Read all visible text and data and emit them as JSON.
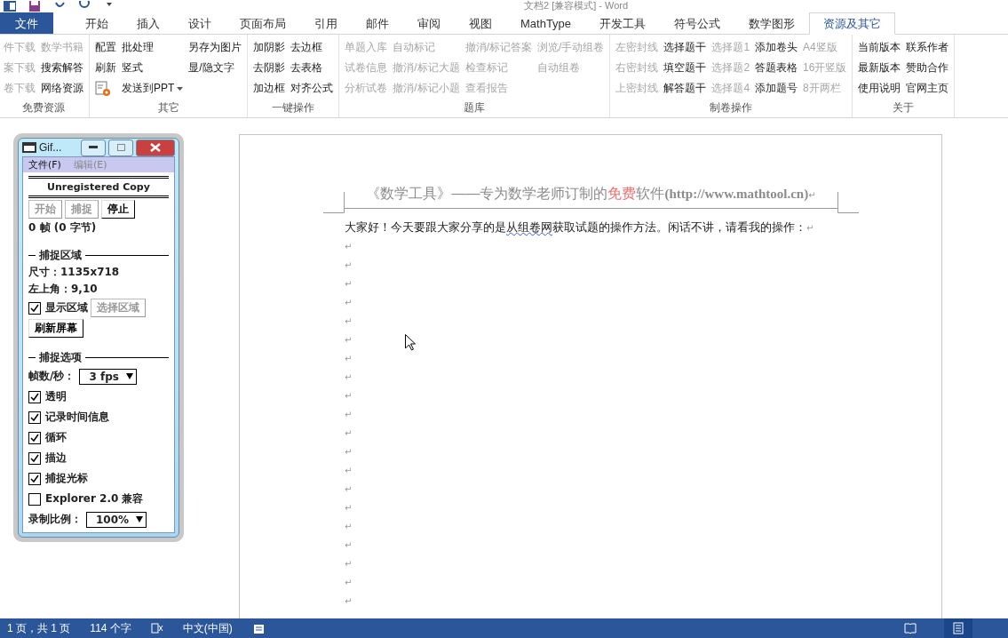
{
  "window": {
    "title": "文档2 [兼容模式] - Word"
  },
  "tabs": [
    {
      "label": "文件",
      "kind": "file",
      "selected": false
    },
    {
      "label": "开始",
      "kind": "tab",
      "selected": false
    },
    {
      "label": "插入",
      "kind": "tab",
      "selected": false
    },
    {
      "label": "设计",
      "kind": "tab",
      "selected": false
    },
    {
      "label": "页面布局",
      "kind": "tab",
      "selected": false
    },
    {
      "label": "引用",
      "kind": "tab",
      "selected": false
    },
    {
      "label": "邮件",
      "kind": "tab",
      "selected": false
    },
    {
      "label": "审阅",
      "kind": "tab",
      "selected": false
    },
    {
      "label": "视图",
      "kind": "tab",
      "selected": false
    },
    {
      "label": "MathType",
      "kind": "tab",
      "selected": false
    },
    {
      "label": "开发工具",
      "kind": "tab",
      "selected": false
    },
    {
      "label": "符号公式",
      "kind": "tab",
      "selected": false
    },
    {
      "label": "数学图形",
      "kind": "tab",
      "selected": false
    },
    {
      "label": "资源及其它",
      "kind": "tab",
      "selected": true
    }
  ],
  "ribbon_groups": [
    {
      "title": "免费资源",
      "columns": [
        [
          {
            "label": "件下载",
            "kind": "text",
            "disabled": true
          },
          {
            "label": "案下载",
            "kind": "text",
            "disabled": true
          },
          {
            "label": "卷下载",
            "kind": "text",
            "disabled": true
          }
        ],
        [
          {
            "label": "数学书籍",
            "kind": "text",
            "disabled": true
          },
          {
            "label": "搜索解答",
            "kind": "text",
            "disabled": false
          },
          {
            "label": "网络资源",
            "kind": "text",
            "disabled": false
          }
        ]
      ]
    },
    {
      "title": "其它",
      "columns": [
        [
          {
            "label": "配置",
            "kind": "text",
            "disabled": false
          },
          {
            "label": "刷新",
            "kind": "text",
            "disabled": false
          },
          {
            "kind": "icon",
            "disabled": false
          }
        ],
        [
          {
            "label": "批处理",
            "kind": "text",
            "disabled": false
          },
          {
            "label": "竖式",
            "kind": "text",
            "disabled": false
          },
          {
            "label": "发送到PPT",
            "kind": "dropdown",
            "disabled": false
          }
        ],
        [
          {
            "label": "另存为图片",
            "kind": "text",
            "disabled": false
          },
          {
            "label": "显/隐文字",
            "kind": "text",
            "disabled": false
          }
        ]
      ]
    },
    {
      "title": "一键操作",
      "columns": [
        [
          {
            "label": "加阴影",
            "kind": "text",
            "disabled": false
          },
          {
            "label": "去阴影",
            "kind": "text",
            "disabled": false
          },
          {
            "label": "加边框",
            "kind": "text",
            "disabled": false
          }
        ],
        [
          {
            "label": "去边框",
            "kind": "text",
            "disabled": false
          },
          {
            "label": "去表格",
            "kind": "text",
            "disabled": false
          },
          {
            "label": "对齐公式",
            "kind": "text",
            "disabled": false
          }
        ]
      ]
    },
    {
      "title": "题库",
      "columns": [
        [
          {
            "label": "单题入库",
            "kind": "text",
            "disabled": true
          },
          {
            "label": "试卷信息",
            "kind": "text",
            "disabled": true
          },
          {
            "label": "分析试卷",
            "kind": "text",
            "disabled": true
          }
        ],
        [
          {
            "label": "自动标记",
            "kind": "text",
            "disabled": true
          },
          {
            "label": "撤消/标记大题",
            "kind": "text",
            "disabled": true
          },
          {
            "label": "撤消/标记小题",
            "kind": "text",
            "disabled": true
          }
        ],
        [
          {
            "label": "撤消/标记答案",
            "kind": "text",
            "disabled": true
          },
          {
            "label": "检查标记",
            "kind": "text",
            "disabled": true
          },
          {
            "label": "查看报告",
            "kind": "text",
            "disabled": true
          }
        ],
        [
          {
            "label": "浏览/手动组卷",
            "kind": "text",
            "disabled": true
          },
          {
            "label": "自动组卷",
            "kind": "text",
            "disabled": true
          }
        ]
      ]
    },
    {
      "title": "制卷操作",
      "columns": [
        [
          {
            "label": "左密封线",
            "kind": "text",
            "disabled": true
          },
          {
            "label": "右密封线",
            "kind": "text",
            "disabled": true
          },
          {
            "label": "上密封线",
            "kind": "text",
            "disabled": true
          }
        ],
        [
          {
            "label": "选择题干",
            "kind": "text",
            "disabled": false
          },
          {
            "label": "填空题干",
            "kind": "text",
            "disabled": false
          },
          {
            "label": "解答题干",
            "kind": "text",
            "disabled": false
          }
        ],
        [
          {
            "label": "选择题1",
            "kind": "text",
            "disabled": true
          },
          {
            "label": "选择题2",
            "kind": "text",
            "disabled": true
          },
          {
            "label": "选择题4",
            "kind": "text",
            "disabled": true
          }
        ],
        [
          {
            "label": "添加卷头",
            "kind": "text",
            "disabled": false
          },
          {
            "label": "答题表格",
            "kind": "text",
            "disabled": false
          },
          {
            "label": "添加题号",
            "kind": "text",
            "disabled": false
          }
        ],
        [
          {
            "label": "A4竖版",
            "kind": "text",
            "disabled": true
          },
          {
            "label": "16开竖版",
            "kind": "text",
            "disabled": true
          },
          {
            "label": "8开两栏",
            "kind": "text",
            "disabled": true
          }
        ]
      ]
    },
    {
      "title": "关于",
      "columns": [
        [
          {
            "label": "当前版本",
            "kind": "text",
            "disabled": false
          },
          {
            "label": "最新版本",
            "kind": "text",
            "disabled": false
          },
          {
            "label": "使用说明",
            "kind": "text",
            "disabled": false
          }
        ],
        [
          {
            "label": "联系作者",
            "kind": "text",
            "disabled": false
          },
          {
            "label": "赞助合作",
            "kind": "text",
            "disabled": false
          },
          {
            "label": "官网主页",
            "kind": "text",
            "disabled": false
          }
        ]
      ]
    }
  ],
  "document": {
    "header": [
      {
        "text": "《数学工具》——专为数学老师订制的",
        "highlight": false
      },
      {
        "text": "免费",
        "highlight": true
      },
      {
        "text": "软件",
        "highlight": false
      },
      {
        "text": "(http://www.mathtool.cn)",
        "kind": "url",
        "highlight": false
      }
    ],
    "header_mark": "↵",
    "body": [
      {
        "text": "大家好！今天要跟大家分享的是",
        "flagged": false
      },
      {
        "text": "从组卷网",
        "flagged": true
      },
      {
        "text": "获取试题的操作方法。闲话不讲，请看我的操作：",
        "flagged": false
      }
    ],
    "body_mark": "↵",
    "paragraph_marks": [
      "↵",
      "↵",
      "↵",
      "↵",
      "↵",
      "↵",
      "↵",
      "↵",
      "↵",
      "↵",
      "↵",
      "↵",
      "↵",
      "↵",
      "↵",
      "↵",
      "↵",
      "↵",
      "↵",
      "↵"
    ]
  },
  "recorder": {
    "title": "Gif...",
    "menu": [
      {
        "label": "文件(F)",
        "disabled": false
      },
      {
        "label": "编辑(E)",
        "disabled": true
      }
    ],
    "banner": "Unregistered Copy",
    "buttons": [
      {
        "label": "开始",
        "disabled": true
      },
      {
        "label": "捕捉",
        "disabled": true
      },
      {
        "label": "停止",
        "disabled": false
      }
    ],
    "status": "0 帧 (0 字节)",
    "area": {
      "title": "捕捉区域",
      "size": "尺寸：1135x718",
      "corner": "左上角：9,10",
      "show_area": {
        "label": "显示区域",
        "checked": true
      },
      "select_button": {
        "label": "选择区域",
        "disabled": true
      },
      "refresh_button": {
        "label": "刷新屏幕",
        "disabled": false
      }
    },
    "options": {
      "title": "捕捉选项",
      "fps_label": "帧数/秒：",
      "fps_value": "3 fps",
      "checks": [
        {
          "label": "透明",
          "checked": true
        },
        {
          "label": "记录时间信息",
          "checked": true
        },
        {
          "label": "循环",
          "checked": true
        },
        {
          "label": "描边",
          "checked": true
        },
        {
          "label": "捕捉光标",
          "checked": true
        },
        {
          "label": "Explorer 2.0 兼容",
          "checked": false
        }
      ],
      "scale_label": "录制比例：",
      "scale_value": "100%"
    }
  },
  "status_bar": {
    "page": "1 页，共 1 页",
    "words": "114 个字",
    "language": "中文(中国)"
  }
}
